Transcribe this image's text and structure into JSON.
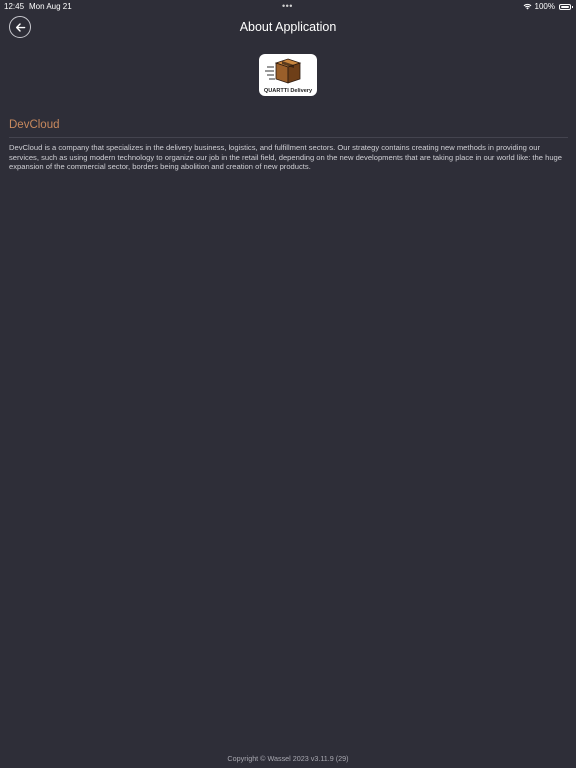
{
  "status_bar": {
    "time": "12:45",
    "date": "Mon Aug 21",
    "multitask_dots": "•••",
    "battery": "100%",
    "wifi_icon": "wifi-icon",
    "battery_icon": "battery-icon"
  },
  "header": {
    "title": "About Application",
    "back_icon": "arrow-left-icon"
  },
  "logo": {
    "icon": "delivery-box-logo",
    "text": "QUARTTI Delivery",
    "accent_color": "#c8853e"
  },
  "company": {
    "name": "DevCloud",
    "description": "DevCloud is a company that specializes in the delivery business, logistics, and fulfillment sectors. Our strategy contains creating new methods in providing our services, such as using modern technology to organize our job in the retail field, depending on the new developments that are taking place in our world like: the huge expansion of the commercial sector, borders being abolition and creation of new products."
  },
  "footer": {
    "copyright": "Copyright © Wassel 2023 v3.11.9 (29)"
  },
  "colors": {
    "background": "#2e2e38",
    "accent": "#c8895e",
    "text": "#ffffff",
    "muted_text": "#cfcfd4"
  }
}
